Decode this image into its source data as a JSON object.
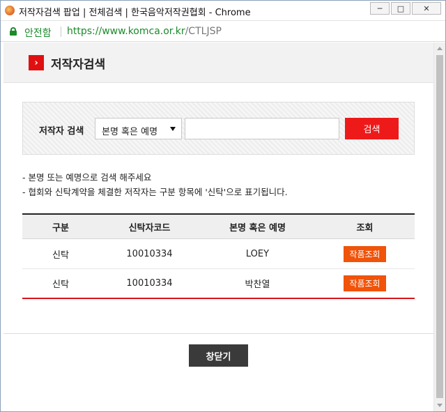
{
  "window": {
    "title": "저작자검색 팝업 | 전체검색 | 한국음악저작권협회 - Chrome",
    "minimize": "─",
    "maximize": "□",
    "close": "✕"
  },
  "address_bar": {
    "secure_label": "안전함",
    "url_scheme": "https://",
    "url_domain": "www.komca.or.kr",
    "url_path": "/CTLJSP"
  },
  "header": {
    "arrow": "›",
    "title": "저작자검색"
  },
  "search": {
    "label": "저작자 검색",
    "select_value": "본명 혹은 예명",
    "input_value": "",
    "button_label": "검색"
  },
  "notes": [
    "- 본명 또는 예명으로 검색 해주세요",
    "- 협회와 신탁계약을 체결한 저작자는 구분 항목에 '신탁'으로 표기됩니다."
  ],
  "table": {
    "columns": [
      "구분",
      "신탁자코드",
      "본명 혹은 예명",
      "조회"
    ],
    "rows": [
      {
        "type": "신탁",
        "code": "10010334",
        "name": "LOEY",
        "action": "작품조회"
      },
      {
        "type": "신탁",
        "code": "10010334",
        "name": "박찬열",
        "action": "작품조회"
      }
    ]
  },
  "footer": {
    "close_label": "창닫기"
  },
  "colors": {
    "accent_red": "#ee1a1a",
    "action_orange": "#f0530a",
    "secure_green": "#1b8a2b"
  }
}
